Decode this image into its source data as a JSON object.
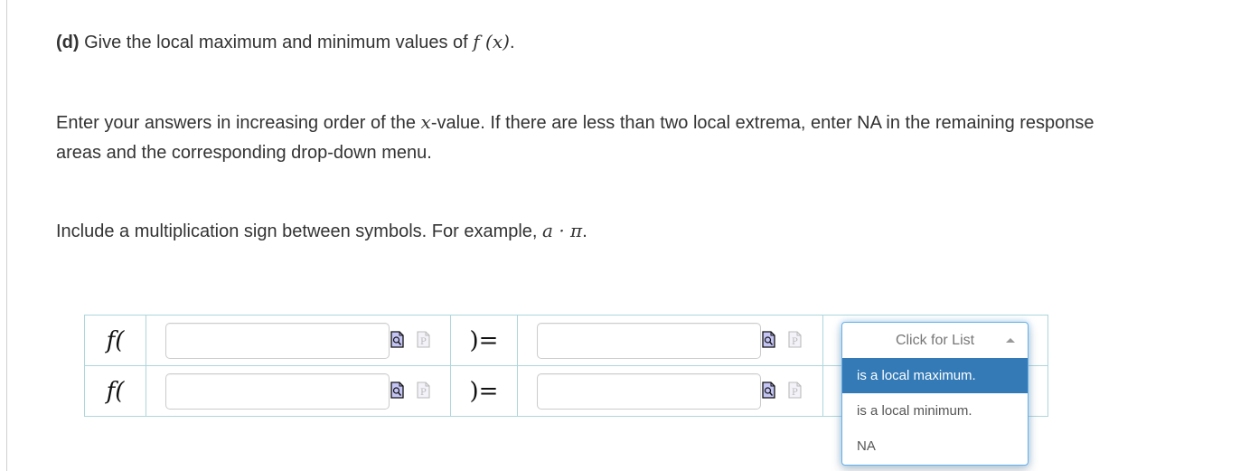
{
  "question": {
    "part_label": "(d)",
    "title_text": "Give the local maximum and minimum values of",
    "function_expr": "f (x)",
    "title_end": "."
  },
  "instructions": {
    "order_pre": "Enter your answers in increasing order of the",
    "order_var": "x",
    "order_post": "-value. If there are less than two local extrema, enter NA in the remaining response areas and the corresponding drop-down menu.",
    "mult_pre": "Include a multiplication sign between symbols. For example,",
    "mult_example": "a · π",
    "mult_end": "."
  },
  "response_table": {
    "rows": [
      {
        "f_open": "f(",
        "x_value": "",
        "eq": ")=",
        "f_value": ""
      },
      {
        "f_open": "f(",
        "x_value": "",
        "eq": ")=",
        "f_value": ""
      }
    ],
    "icons": {
      "preview": "preview-document-icon",
      "palette": "p-document-icon"
    }
  },
  "dropdown": {
    "placeholder": "Click for List",
    "state": "open",
    "options": [
      "is a local maximum.",
      "is a local minimum.",
      "NA"
    ],
    "highlighted_index": 0,
    "highlight_color": "#337ab7",
    "focus_border_color": "#66afe9"
  }
}
